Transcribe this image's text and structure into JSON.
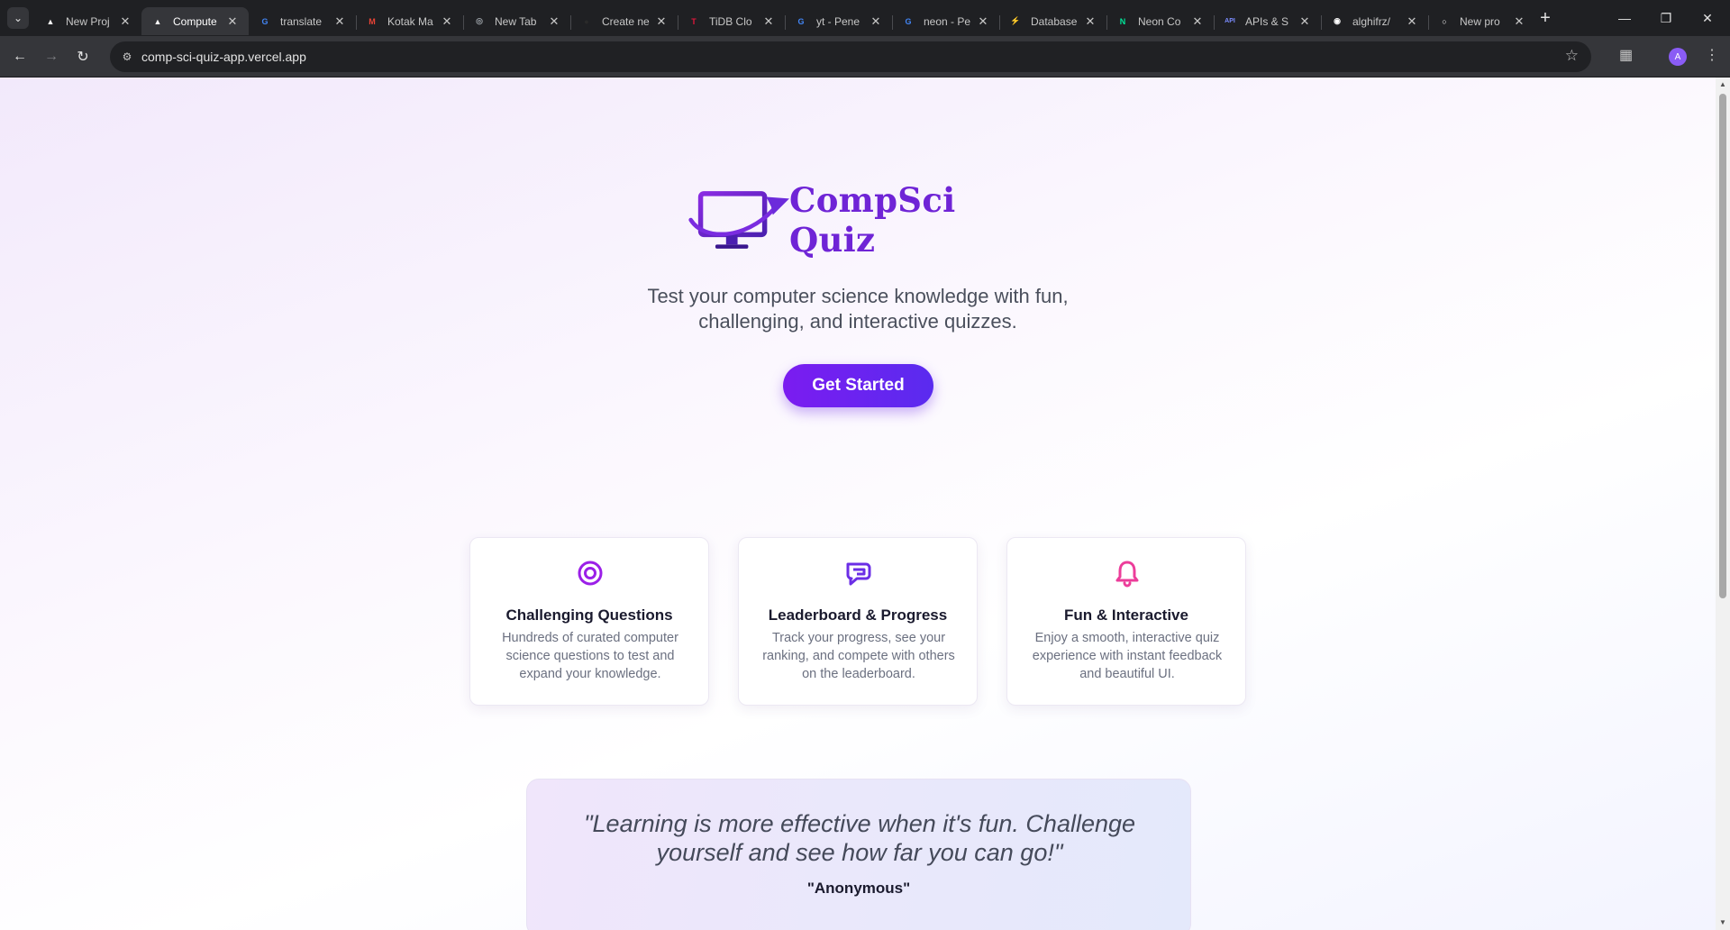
{
  "browser": {
    "tabs": [
      {
        "title": "New Proj",
        "favicon": "vercel-triangle-icon",
        "favicon_color": "#ffffff",
        "active": false
      },
      {
        "title": "Compute",
        "favicon": "vercel-triangle-icon",
        "favicon_color": "#ffffff",
        "active": true
      },
      {
        "title": "translate",
        "favicon": "google-icon",
        "favicon_color": "#4285f4",
        "active": false
      },
      {
        "title": "Kotak Ma",
        "favicon": "gmail-icon",
        "favicon_color": "#ea4335",
        "active": false
      },
      {
        "title": "New Tab",
        "favicon": "chrome-icon",
        "favicon_color": "#9aa0a6",
        "active": false
      },
      {
        "title": "Create ne",
        "favicon": "dark-site-icon",
        "favicon_color": "#2a2a2a",
        "active": false
      },
      {
        "title": "TiDB Clo",
        "favicon": "tidb-icon",
        "favicon_color": "#e0163b",
        "active": false
      },
      {
        "title": "yt - Pene",
        "favicon": "google-icon",
        "favicon_color": "#4285f4",
        "active": false
      },
      {
        "title": "neon - Pe",
        "favicon": "google-icon",
        "favicon_color": "#4285f4",
        "active": false
      },
      {
        "title": "Database",
        "favicon": "supabase-icon",
        "favicon_color": "#3ecf8e",
        "active": false
      },
      {
        "title": "Neon Co",
        "favicon": "neon-icon",
        "favicon_color": "#00e599",
        "active": false
      },
      {
        "title": "APIs & S",
        "favicon": "api-icon",
        "favicon_color": "#7b8cff",
        "active": false
      },
      {
        "title": "alghifrz/",
        "favicon": "github-icon",
        "favicon_color": "#ffffff",
        "active": false
      },
      {
        "title": "New pro",
        "favicon": "generic-site-icon",
        "favicon_color": "#ffffff",
        "active": false
      }
    ],
    "url": "comp-sci-quiz-app.vercel.app",
    "profile_initial": "A"
  },
  "page": {
    "brand": "CompSci Quiz",
    "tagline": "Test your computer science knowledge with fun, challenging, and interactive quizzes.",
    "cta_label": "Get Started",
    "features": [
      {
        "icon": "target-icon",
        "color": "#9b1fe8",
        "title": "Challenging Questions",
        "description": "Hundreds of curated computer science questions to test and expand your knowledge."
      },
      {
        "icon": "chat-icon",
        "color": "#6b2ee6",
        "title": "Leaderboard & Progress",
        "description": "Track your progress, see your ranking, and compete with others on the leaderboard."
      },
      {
        "icon": "bell-icon",
        "color": "#ec3d9a",
        "title": "Fun & Interactive",
        "description": "Enjoy a smooth, interactive quiz experience with instant feedback and beautiful UI."
      }
    ],
    "quote": {
      "text": "\"Learning is more effective when it's fun. Challenge yourself and see how far you can go!\"",
      "author": "\"Anonymous\""
    }
  },
  "colors": {
    "brand_purple": "#6f24d6",
    "cta_gradient_start": "#7b1cf0",
    "cta_gradient_end": "#5a2bef"
  }
}
